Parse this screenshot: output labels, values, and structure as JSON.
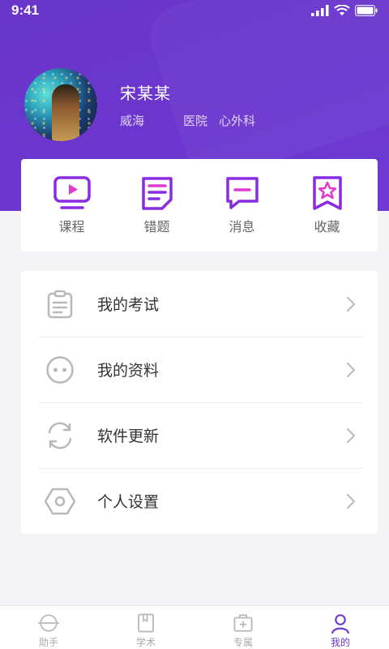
{
  "status_bar": {
    "time": "9:41"
  },
  "profile": {
    "name": "宋某某",
    "city": "威海",
    "hospital": "医院",
    "department": "心外科"
  },
  "quick_actions": [
    {
      "label": "课程",
      "icon": "course-video-icon"
    },
    {
      "label": "错题",
      "icon": "wrong-questions-icon"
    },
    {
      "label": "消息",
      "icon": "message-icon"
    },
    {
      "label": "收藏",
      "icon": "favorites-star-icon"
    }
  ],
  "menu": [
    {
      "label": "我的考试",
      "icon": "clipboard-icon"
    },
    {
      "label": "我的资料",
      "icon": "profile-face-icon"
    },
    {
      "label": "软件更新",
      "icon": "refresh-icon"
    },
    {
      "label": "个人设置",
      "icon": "settings-hexagon-icon"
    }
  ],
  "tabbar": [
    {
      "label": "助手",
      "icon": "assistant-icon",
      "active": false
    },
    {
      "label": "学术",
      "icon": "academic-book-icon",
      "active": false
    },
    {
      "label": "专属",
      "icon": "exclusive-medkit-icon",
      "active": false
    },
    {
      "label": "我的",
      "icon": "user-icon",
      "active": true
    }
  ],
  "colors": {
    "primary": "#6c36cf",
    "accent_purple": "#8a2be2",
    "text": "#333333",
    "muted": "#aaaaaa"
  }
}
